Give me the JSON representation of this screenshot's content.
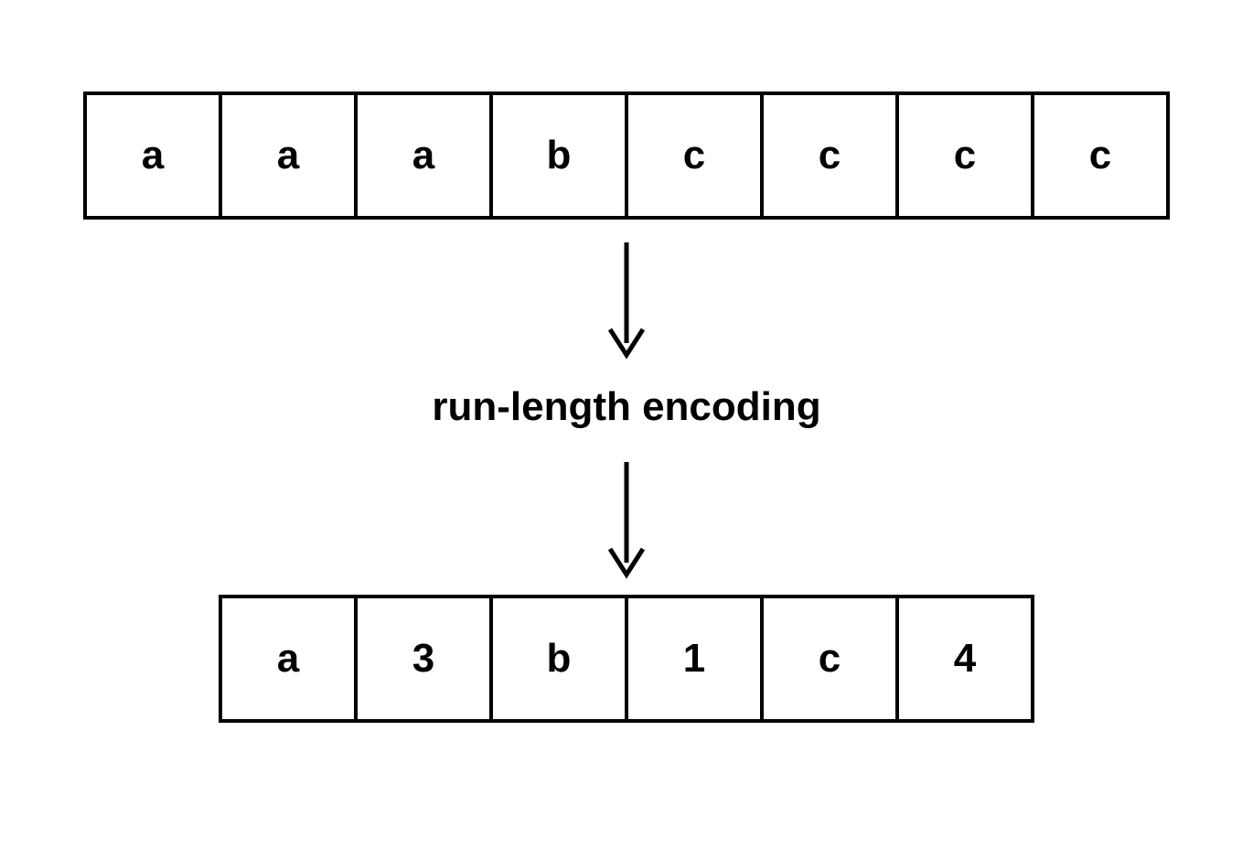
{
  "input_array": [
    "a",
    "a",
    "a",
    "b",
    "c",
    "c",
    "c",
    "c"
  ],
  "label": "run-length encoding",
  "output_array": [
    "a",
    "3",
    "b",
    "1",
    "c",
    "4"
  ]
}
